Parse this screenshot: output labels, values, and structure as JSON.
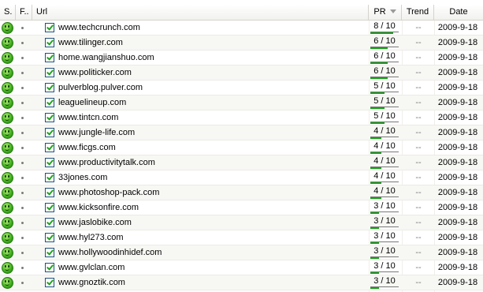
{
  "columns": {
    "status": "S.",
    "flag": "F..",
    "url": "Url",
    "pr": "PR",
    "trend": "Trend",
    "date": "Date"
  },
  "icons": {
    "status": "smiley-ok-icon",
    "flag": "dot-icon",
    "check": "checkbox-checked-icon",
    "sort": "sort-descending-icon"
  },
  "colors": {
    "status_green": "#3fb01d",
    "pr_bar": "#18a018"
  },
  "rows": [
    {
      "url": "www.techcrunch.com",
      "pr": "8 / 10",
      "pr_value": 8,
      "trend": "--",
      "date": "2009-9-18"
    },
    {
      "url": "www.tilinger.com",
      "pr": "6 / 10",
      "pr_value": 6,
      "trend": "--",
      "date": "2009-9-18"
    },
    {
      "url": "home.wangjianshuo.com",
      "pr": "6 / 10",
      "pr_value": 6,
      "trend": "--",
      "date": "2009-9-18"
    },
    {
      "url": "www.politicker.com",
      "pr": "6 / 10",
      "pr_value": 6,
      "trend": "--",
      "date": "2009-9-18"
    },
    {
      "url": "pulverblog.pulver.com",
      "pr": "5 / 10",
      "pr_value": 5,
      "trend": "--",
      "date": "2009-9-18"
    },
    {
      "url": "leaguelineup.com",
      "pr": "5 / 10",
      "pr_value": 5,
      "trend": "--",
      "date": "2009-9-18"
    },
    {
      "url": "www.tintcn.com",
      "pr": "5 / 10",
      "pr_value": 5,
      "trend": "--",
      "date": "2009-9-18"
    },
    {
      "url": "www.jungle-life.com",
      "pr": "4 / 10",
      "pr_value": 4,
      "trend": "--",
      "date": "2009-9-18"
    },
    {
      "url": "www.ficgs.com",
      "pr": "4 / 10",
      "pr_value": 4,
      "trend": "--",
      "date": "2009-9-18"
    },
    {
      "url": "www.productivitytalk.com",
      "pr": "4 / 10",
      "pr_value": 4,
      "trend": "--",
      "date": "2009-9-18"
    },
    {
      "url": "33jones.com",
      "pr": "4 / 10",
      "pr_value": 4,
      "trend": "--",
      "date": "2009-9-18"
    },
    {
      "url": "www.photoshop-pack.com",
      "pr": "4 / 10",
      "pr_value": 4,
      "trend": "--",
      "date": "2009-9-18"
    },
    {
      "url": "www.kicksonfire.com",
      "pr": "3 / 10",
      "pr_value": 3,
      "trend": "--",
      "date": "2009-9-18"
    },
    {
      "url": "www.jaslobike.com",
      "pr": "3 / 10",
      "pr_value": 3,
      "trend": "--",
      "date": "2009-9-18"
    },
    {
      "url": "www.hyl273.com",
      "pr": "3 / 10",
      "pr_value": 3,
      "trend": "--",
      "date": "2009-9-18"
    },
    {
      "url": "www.hollywoodinhidef.com",
      "pr": "3 / 10",
      "pr_value": 3,
      "trend": "--",
      "date": "2009-9-18"
    },
    {
      "url": "www.gvlclan.com",
      "pr": "3 / 10",
      "pr_value": 3,
      "trend": "--",
      "date": "2009-9-18"
    },
    {
      "url": "www.gnoztik.com",
      "pr": "3 / 10",
      "pr_value": 3,
      "trend": "--",
      "date": "2009-9-18"
    }
  ]
}
